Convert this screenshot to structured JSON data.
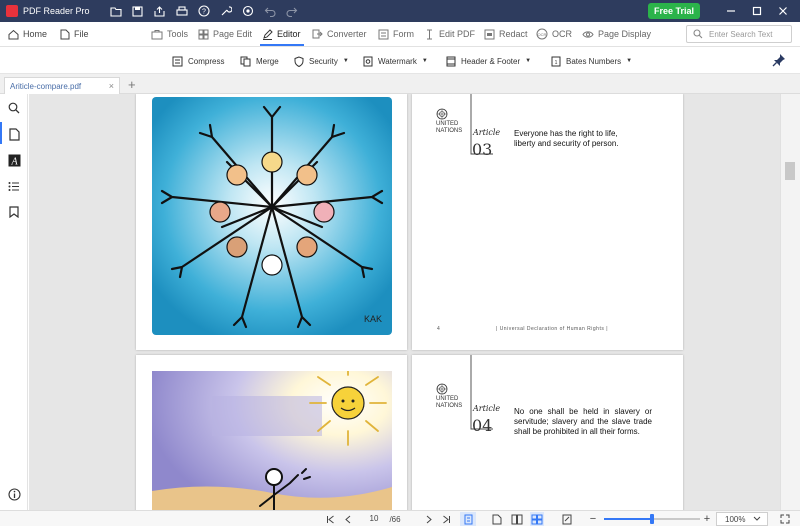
{
  "app": {
    "title": "PDF Reader Pro",
    "free_trial_label": "Free Trial",
    "accent_color": "#3478f6",
    "titlebar_color": "#2e3c5e",
    "trial_color": "#2bb34a"
  },
  "window_controls": [
    "minimize-icon",
    "maximize-icon",
    "close-icon"
  ],
  "quick_toolbar_icons": [
    "open-folder-icon",
    "save-icon",
    "share-icon",
    "print-icon",
    "help-icon",
    "wrench-icon",
    "settings-icon",
    "undo-icon",
    "redo-icon"
  ],
  "menu": {
    "home": "Home",
    "file": "File",
    "tools": "Tools",
    "page_edit": "Page Edit",
    "editor": "Editor",
    "converter": "Converter",
    "form": "Form",
    "edit_pdf": "Edit PDF",
    "redact": "Redact",
    "ocr": "OCR",
    "page_display": "Page Display",
    "search_placeholder": "Enter Search Text"
  },
  "subtoolbar": {
    "compress": "Compress",
    "merge": "Merge",
    "security": "Security",
    "watermark": "Watermark",
    "header_footer": "Header & Footer",
    "bates_numbers": "Bates Numbers"
  },
  "tab": {
    "filename": "Ariticle-compare.pdf",
    "close": "×",
    "add": "+"
  },
  "left_sidebar_icons": [
    "search-icon",
    "page-thumbnails-icon",
    "text-icon",
    "outline-list-icon",
    "bookmark-icon",
    "info-icon"
  ],
  "document": {
    "un_label_line1": "UNITED",
    "un_label_line2": "NATIONS",
    "article_word": "Article",
    "article_3_number": "03",
    "article_3_text": "Everyone has the right to life, liberty and security of person.",
    "article_4_number": "04",
    "article_4_text": "No one shall be held in slavery or servitude; slavery and the slave trade shall be prohibited in all their forms.",
    "footer_page": "4",
    "footer_title": "| Universal Declaration of Human Rights |",
    "art_signature": "KAK"
  },
  "status": {
    "current_page": "10",
    "total_pages": "/66",
    "zoom": "100%",
    "zoom_fraction": 0.5
  }
}
